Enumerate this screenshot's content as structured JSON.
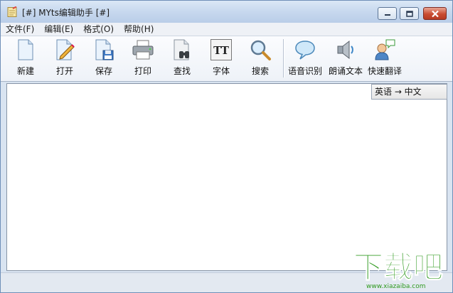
{
  "window": {
    "title": "[#] MYts编辑助手 [#]"
  },
  "menu": [
    {
      "id": "file",
      "label": "文件(F)"
    },
    {
      "id": "edit",
      "label": "编辑(E)"
    },
    {
      "id": "format",
      "label": "格式(O)"
    },
    {
      "id": "help",
      "label": "帮助(H)"
    }
  ],
  "toolbar": {
    "new": "新建",
    "open": "打开",
    "save": "保存",
    "print": "打印",
    "find": "查找",
    "font": "字体",
    "search": "搜索",
    "speech_recognition": "语音识别",
    "read_aloud": "朗诵文本",
    "quick_translate": "快速翻译",
    "font_icon_text": "TT"
  },
  "translation": {
    "direction": "英语 → 中文"
  },
  "watermark": {
    "logo_text": "下载吧",
    "url": "www.xiazaiba.com"
  },
  "colors": {
    "title_bar": "#c7d8ee",
    "close_button": "#c94c32",
    "watermark_green": "#2f9a1f"
  }
}
